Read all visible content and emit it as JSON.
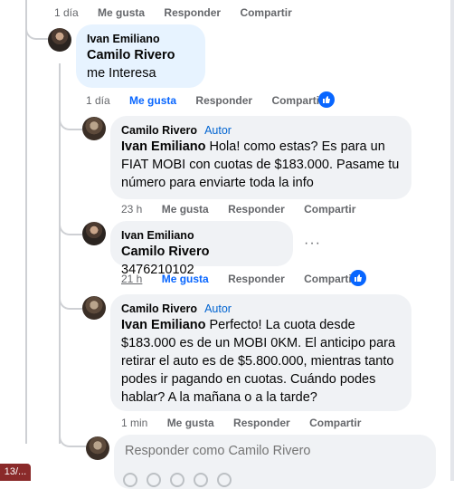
{
  "top_actions": {
    "time": "1 día",
    "like": "Me gusta",
    "reply": "Responder",
    "share": "Compartir"
  },
  "comments": [
    {
      "author": "Ivan Emiliano",
      "mention": "Camilo Rivero",
      "text": " me Interesa",
      "actions": {
        "time": "1 día",
        "like": "Me gusta",
        "reply": "Responder",
        "share": "Compartir"
      }
    },
    {
      "author": "Camilo Rivero",
      "badge": "Autor",
      "mention": "Ivan Emiliano",
      "text": " Hola! como estas? Es para un FIAT MOBI con cuotas de $183.000. Pasame tu número para enviarte toda la info",
      "actions": {
        "time": "23 h",
        "like": "Me gusta",
        "reply": "Responder",
        "share": "Compartir"
      }
    },
    {
      "author": "Ivan Emiliano",
      "mention": "Camilo Rivero",
      "text": " 3476210102",
      "more": "···",
      "actions": {
        "time": "21 h",
        "like": "Me gusta",
        "reply": "Responder",
        "share": "Compartir"
      }
    },
    {
      "author": "Camilo Rivero",
      "badge": "Autor",
      "mention": "Ivan Emiliano",
      "text": " Perfecto! La cuota desde $183.000 es de un MOBI 0KM. El anticipo para retirar el auto es de $5.800.000, mientras tanto podes ir pagando en cuotas. Cuándo podes hablar? A la mañana o a la tarde?",
      "actions": {
        "time": "1 min",
        "like": "Me gusta",
        "reply": "Responder",
        "share": "Compartir"
      }
    }
  ],
  "reply_box": {
    "placeholder": "Responder como Camilo Rivero"
  },
  "tab": {
    "label": "13/..."
  },
  "colors": {
    "accent": "#0866ff",
    "bubble": "#f0f2f5",
    "bubble_active": "#e7f3ff",
    "muted": "#65676b"
  },
  "icons": {
    "like": "thumbs-up-icon",
    "more": "more-options-icon"
  }
}
